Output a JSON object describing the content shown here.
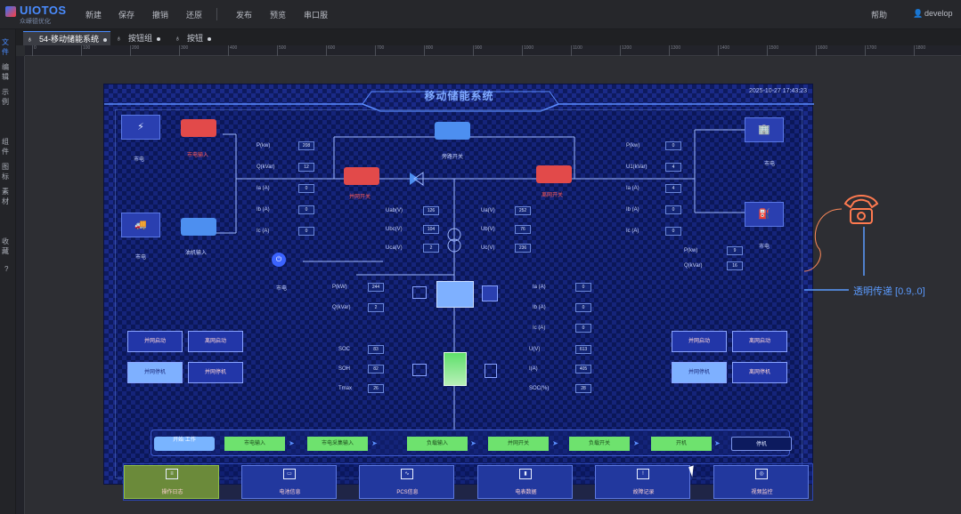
{
  "app": {
    "name": "UIOTOS",
    "subtitle": "众嵘德优化"
  },
  "top_menu": [
    "新建",
    "保存",
    "撤销",
    "还原",
    "发布",
    "预览",
    "串口服"
  ],
  "top_right": {
    "help": "帮助",
    "user": "develop"
  },
  "tabs": [
    {
      "label": "54-移动储能系统",
      "active": true
    },
    {
      "label": "按钮组",
      "active": false
    },
    {
      "label": "按钮",
      "active": false
    }
  ],
  "sidebar": [
    "文件",
    "编辑",
    "示例",
    "组件",
    "图标",
    "素材",
    "收藏"
  ],
  "ruler_top": [
    "0",
    "100",
    "200",
    "300",
    "400",
    "500",
    "600",
    "700",
    "800",
    "900",
    "1000",
    "1100",
    "1200",
    "1300",
    "1400",
    "1500",
    "1600",
    "1700",
    "1800",
    "1900"
  ],
  "screen": {
    "title": "移动储能系统",
    "datetime": "2025-10-27    17:43:23",
    "labels": {
      "grid1": "市电",
      "grid_input": "市电输入",
      "gen": "市电",
      "gen_input": "油机输入",
      "ac_main": "市电",
      "in_switch": "并网开关",
      "bypass": "旁路开关",
      "out_switch": "离网开关",
      "load1": "市电",
      "load2": "市电"
    },
    "meas_left": [
      "P(kw)",
      "Q(kVar)",
      "Ia (A)",
      "Ib (A)",
      "Ic (A)"
    ],
    "meas_left_vals": [
      "208",
      "12",
      "0",
      "0",
      "0"
    ],
    "meas_mid_left": [
      "Uab(V)",
      "Ubc(V)",
      "Uca(V)"
    ],
    "meas_mid_left_vals": [
      "126",
      "104",
      "2"
    ],
    "meas_mid_right": [
      "Ua(V)",
      "Ub(V)",
      "Uc(V)"
    ],
    "meas_mid_right_vals": [
      "252",
      "76",
      "236"
    ],
    "meas_right": [
      "P(kw)",
      "U1(kVar)",
      "Ia (A)",
      "Ib (A)",
      "Ic (A)"
    ],
    "meas_right_vals": [
      "0",
      "4",
      "4",
      "0",
      "0"
    ],
    "meas_right2": [
      "P(kw)",
      "Q(kVar)"
    ],
    "meas_right2_vals": [
      "9",
      "16"
    ],
    "pcs_left": [
      "P(kW)",
      "Q(kVar)"
    ],
    "pcs_left_vals": [
      "244",
      "2"
    ],
    "pcs_right": [
      "Ia (A)",
      "Ib (A)",
      "Ic (A)"
    ],
    "pcs_right_vals": [
      "0",
      "0",
      "0"
    ],
    "bat_left": [
      "SOC",
      "SOH",
      "Tmax"
    ],
    "bat_left_vals": [
      "83",
      "82",
      "26"
    ],
    "bat_right": [
      "U(V)",
      "I(A)",
      "SOC(%)"
    ],
    "bat_right_vals": [
      "613",
      "405",
      "28"
    ],
    "controls_left": [
      "并网启动",
      "离网启动",
      "并网停机",
      "并网停机"
    ],
    "controls_right": [
      "并网启动",
      "离网启动",
      "并网停机",
      "离网停机"
    ],
    "flow": [
      "开始\n工作",
      "市电输入",
      "市电采集输入",
      "负载输入",
      "并网开关",
      "负载开关",
      "开机",
      "停机"
    ],
    "bottom": [
      "操作日志",
      "电池信息",
      "PCS信息",
      "电表数据",
      "故障记录",
      "视频监控"
    ]
  },
  "passthrough": "透明传递 [0.9,.0]"
}
